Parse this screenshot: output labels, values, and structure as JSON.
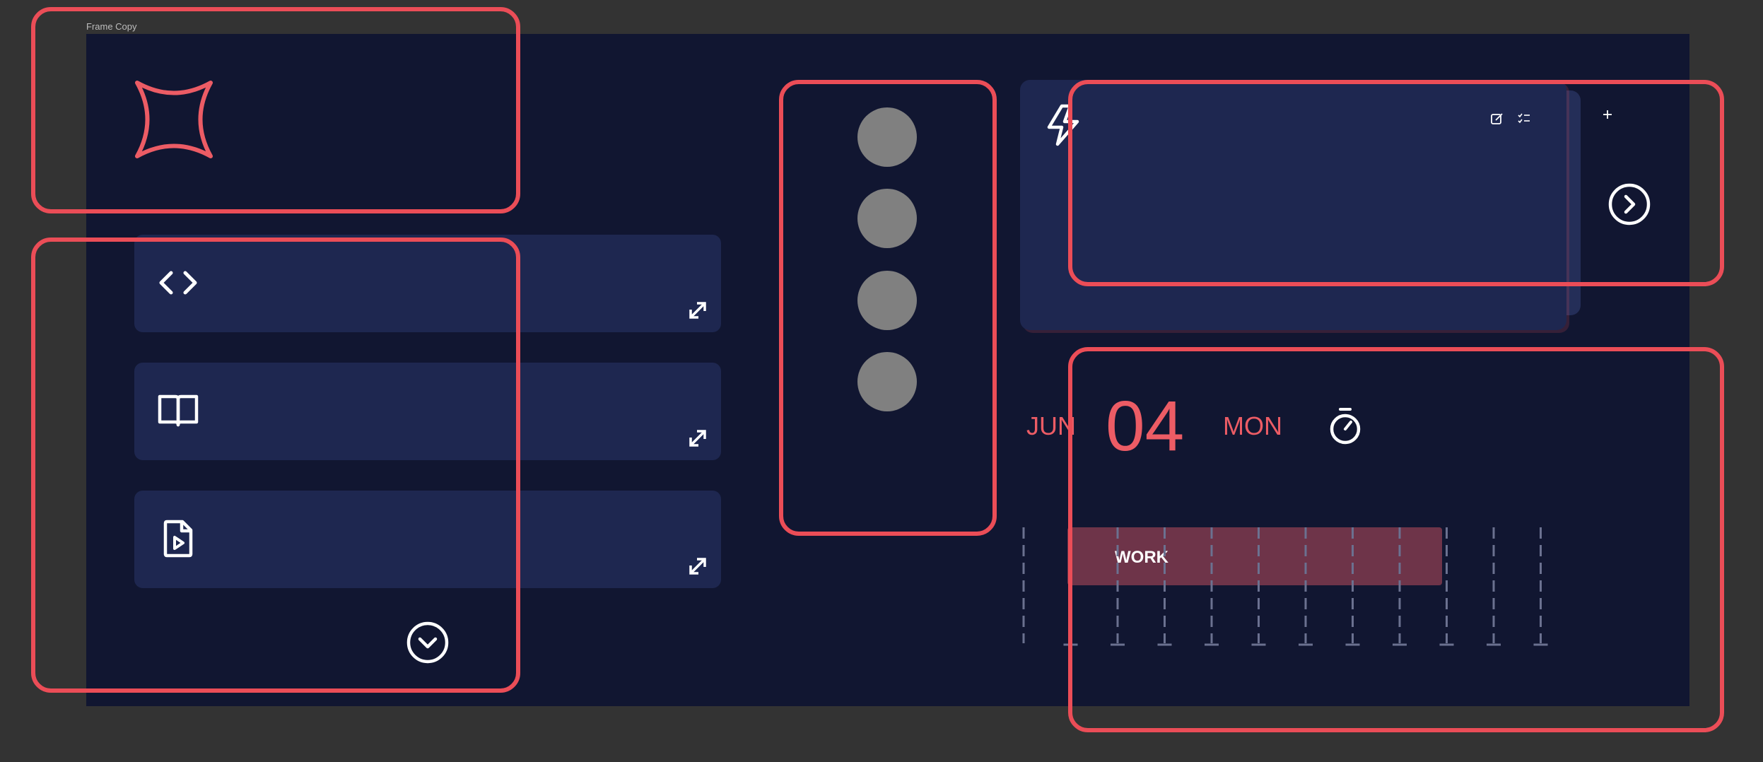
{
  "frame": {
    "title": "Frame Copy"
  },
  "date": {
    "month": "JUN",
    "day": "04",
    "weekday": "MON"
  },
  "schedule": {
    "block_label": "WORK",
    "columns": 12
  },
  "menu": {
    "dot_count": 4
  },
  "icons": {
    "logo": "sparkle-star-icon",
    "card1": "code-icon",
    "card2": "book-icon",
    "card3": "video-file-icon",
    "expand": "expand-arrows-icon",
    "collapse": "chevron-down-circle-icon",
    "next": "chevron-right-circle-icon",
    "bolt": "lightning-icon",
    "edit": "edit-icon",
    "checklist": "checklist-icon",
    "add": "plus-icon",
    "timer": "stopwatch-icon"
  },
  "colors": {
    "background": "#333333",
    "frame": "#111631",
    "card": "#1e2750",
    "accent": "#eb4d57",
    "work_block": "#6e3449",
    "placeholder": "#808080"
  }
}
